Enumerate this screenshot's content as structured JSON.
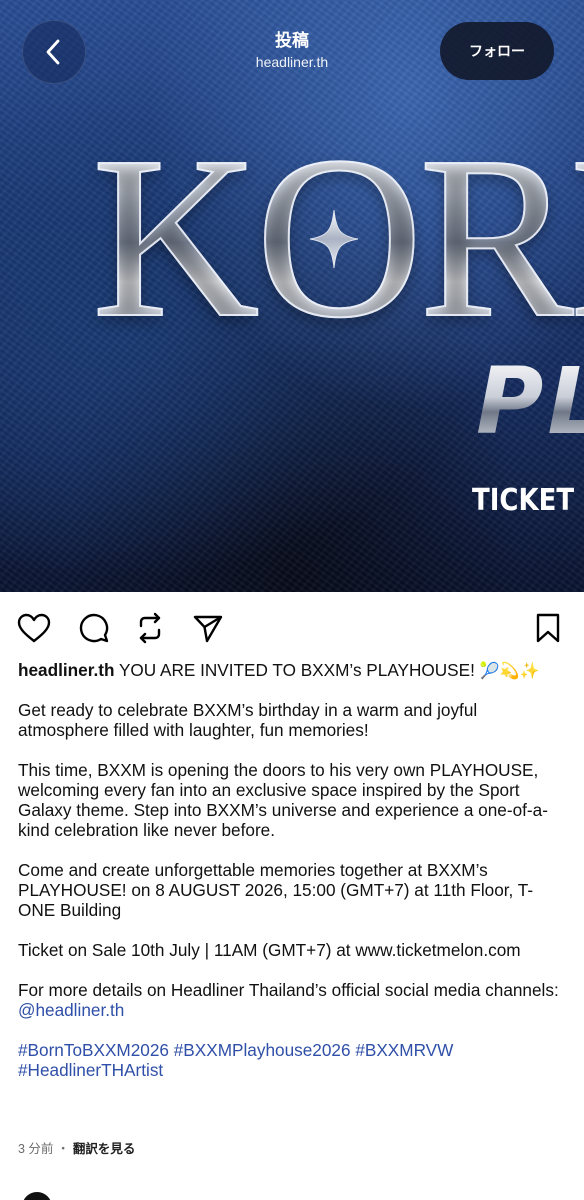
{
  "header": {
    "title": "投稿",
    "subtitle": "headliner.th",
    "follow_label": "フォロー"
  },
  "hero": {
    "title_text": "KORN",
    "subtitle_text": "PLAYHOUSE",
    "ticket_text": "TICKET ON SALE"
  },
  "actions": {
    "icons": [
      "heart-icon",
      "comment-icon",
      "repost-icon",
      "share-icon",
      "bookmark-icon"
    ]
  },
  "caption": {
    "username": "headliner.th",
    "headline": "YOU ARE INVITED TO BXXM’s PLAYHOUSE!",
    "headline_emojis": "🎾💫✨",
    "p1": "Get ready to celebrate BXXM’s birthday in a warm and joyful atmosphere filled with laughter, fun memories!",
    "p2": "This time, BXXM is opening the doors to his very own PLAYHOUSE, welcoming every fan into an exclusive space inspired by the Sport Galaxy theme. Step into BXXM’s universe and experience a one-of-a-kind celebration like never before.",
    "p3": "Come and create unforgettable memories together at BXXM’s PLAYHOUSE! on 8 AUGUST 2026, 15:00 (GMT+7) at 11th Floor, T-ONE Building",
    "p4": "Ticket on Sale 10th July | 11AM (GMT+7) at www.ticketmelon.com",
    "p5_text": "For more details on Headliner Thailand’s official social media channels:",
    "p5_mention": "@headliner.th",
    "hashtags": [
      "#BornToBXXM2026",
      "#BXXMPlayhouse2026",
      "#BXXMRVW",
      "#HeadlinerTHArtist"
    ]
  },
  "meta": {
    "time_ago": "3 分前",
    "separator": "・",
    "translate_label": "翻訳を見る"
  },
  "colors": {
    "link": "#2f4fa8",
    "hero_blue": "#1c3a78"
  }
}
